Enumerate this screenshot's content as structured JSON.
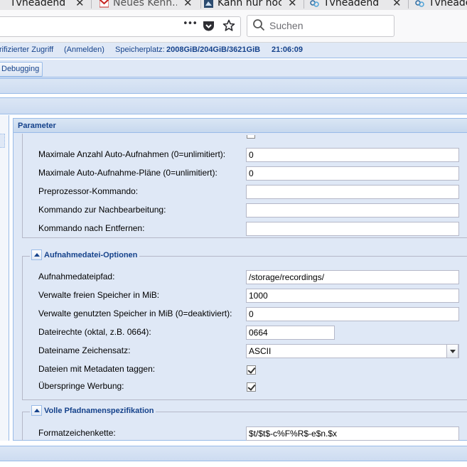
{
  "browser": {
    "tabs": [
      {
        "label": "Tvheadend"
      },
      {
        "label": "Neues Kenn..."
      },
      {
        "label": "Kann nur noch"
      },
      {
        "label": "Tvheadend"
      },
      {
        "label": "Tvheade"
      }
    ],
    "search_placeholder": "Suchen",
    "url_menu_icon": "•••"
  },
  "status": {
    "access": "rifizierter Zugriff",
    "login": "(Anmelden)",
    "storage_label": "Speicherplatz:",
    "storage_value": "2008GiB/204GiB/3621GiB",
    "time": "21:06:09"
  },
  "toolbar": {
    "debugging_label": "Debugging"
  },
  "panel": {
    "title": "Parameter",
    "top_rows": [
      {
        "label": "Maximale Anzahl Auto-Aufnahmen (0=unlimitiert):",
        "value": "0"
      },
      {
        "label": "Maximale Auto-Aufnahme-Pläne (0=unlimitiert):",
        "value": "0"
      },
      {
        "label": "Preprozessor-Kommando:",
        "value": ""
      },
      {
        "label": "Kommando zur Nachbearbeitung:",
        "value": ""
      },
      {
        "label": "Kommando nach Entfernen:",
        "value": ""
      }
    ],
    "file_options": {
      "legend": "Aufnahmedatei-Optionen",
      "path_label": "Aufnahmedateipfad:",
      "path_value": "/storage/recordings/",
      "free_label": "Verwalte freien Speicher in MiB:",
      "free_value": "1000",
      "used_label": "Verwalte genutzten Speicher in MiB (0=deaktiviert):",
      "used_value": "0",
      "rights_label": "Dateirechte (oktal, z.B. 0664):",
      "rights_value": "0664",
      "charset_label": "Dateiname Zeichensatz:",
      "charset_value": "ASCII",
      "tag_label": "Dateien mit Metadaten taggen:",
      "tag_checked": true,
      "skip_label": "Überspringe Werbung:",
      "skip_checked": true
    },
    "path_spec": {
      "legend": "Volle Pfadnamenspezifikation",
      "format_label": "Formatzeichenkette:",
      "format_value": "$t/$t$-c%F%R$-e$n.$x"
    }
  }
}
